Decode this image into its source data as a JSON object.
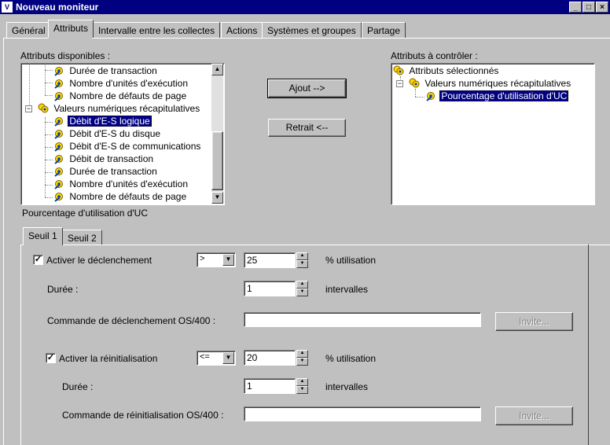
{
  "window": {
    "title": "Nouveau moniteur",
    "minimize": "_",
    "maximize": "□",
    "close": "×"
  },
  "tabs": [
    "Général",
    "Attributs",
    "Intervalle entre les collectes",
    "Actions",
    "Systèmes et groupes",
    "Partage"
  ],
  "active_tab": "Attributs",
  "available": {
    "label": "Attributs disponibles :",
    "items": [
      "Durée de transaction",
      "Nombre d'unités d'exécution",
      "Nombre de défauts de page",
      "Valeurs numériques récapitulatives",
      "Débit d'E-S logique",
      "Débit d'E-S du disque",
      "Débit d'E-S de communications",
      "Débit de transaction",
      "Durée de transaction",
      "Nombre d'unités d'exécution",
      "Nombre de défauts de page"
    ],
    "selected": "Débit d'E-S logique",
    "expand_symbol": "−"
  },
  "buttons": {
    "add": "Ajout -->",
    "remove": "Retrait <--"
  },
  "monitored": {
    "label": "Attributs à contrôler :",
    "root": "Attributs sélectionnés",
    "group": "Valeurs numériques récapitulatives",
    "item": "Pourcentage d'utilisation d'UC",
    "expand_symbol": "−"
  },
  "selected_attribute_label": "Pourcentage d'utilisation d'UC",
  "threshold_tabs": [
    "Seuil 1",
    "Seuil 2"
  ],
  "trigger": {
    "checkbox_label": "Activer le déclenchement",
    "checked": true,
    "operator": ">",
    "value": "25",
    "unit": "% utilisation",
    "duration_label": "Durée :",
    "duration_value": "1",
    "duration_unit": "intervalles",
    "command_label": "Commande de déclenchement OS/400 :",
    "command_value": "",
    "prompt_button": "Invite..."
  },
  "reset": {
    "checkbox_label": "Activer la réinitialisation",
    "checked": true,
    "operator": "<=",
    "value": "20",
    "unit": "% utilisation",
    "duration_label": "Durée :",
    "duration_value": "1",
    "duration_unit": "intervalles",
    "command_label": "Commande de réinitialisation OS/400 :",
    "command_value": "",
    "prompt_button": "Invite..."
  },
  "symbols": {
    "check": "✓",
    "arrow_down": "▼",
    "arrow_up": "▲",
    "spin_up": "▲",
    "spin_down": "▼"
  }
}
